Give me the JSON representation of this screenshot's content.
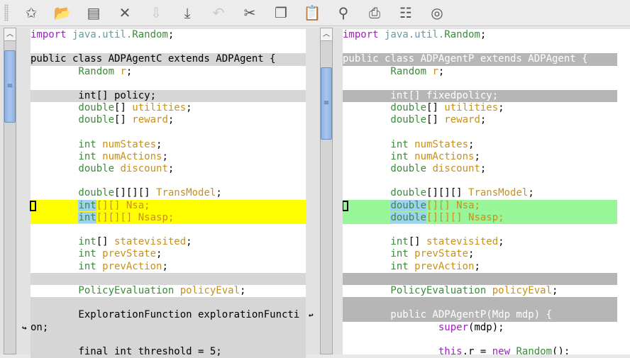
{
  "toolbar": {
    "icons": [
      "new-file-icon",
      "open-folder-icon",
      "save-icon",
      "close-icon",
      "download-icon",
      "save-as-icon",
      "undo-icon",
      "cut-icon",
      "copy-icon",
      "paste-icon",
      "find-icon",
      "print-icon",
      "settings-icon",
      "help-icon"
    ],
    "glyphs": [
      "✩",
      "📂",
      "▤",
      "✕",
      "⇩",
      "⤓",
      "↶",
      "✂",
      "❐",
      "📋",
      "⚲",
      "⎙",
      "☷",
      "◎"
    ],
    "disabled": [
      4,
      6
    ]
  },
  "left": {
    "lines": [
      {
        "bg": "",
        "tokens": [
          {
            "t": "import",
            "c": "kw"
          },
          {
            "t": " java.util.",
            "c": "pk"
          },
          {
            "t": "Random",
            "c": "ty"
          },
          {
            "t": ";",
            "c": "pl"
          }
        ]
      },
      {
        "bg": "",
        "tokens": []
      },
      {
        "bg": "g",
        "tokens": [
          {
            "t": "public class ADPAgentC extends ADPAgent {",
            "c": "pl"
          }
        ]
      },
      {
        "bg": "",
        "tokens": [
          {
            "t": "        Random",
            "c": "ty"
          },
          {
            "t": " r",
            "c": "id"
          },
          {
            "t": ";",
            "c": "pl"
          }
        ]
      },
      {
        "bg": "",
        "tokens": []
      },
      {
        "bg": "g",
        "tokens": [
          {
            "t": "        int[] policy;",
            "c": "pl"
          }
        ]
      },
      {
        "bg": "",
        "tokens": [
          {
            "t": "        double",
            "c": "ty"
          },
          {
            "t": "[]",
            "c": "pl"
          },
          {
            "t": " utilities",
            "c": "id"
          },
          {
            "t": ";",
            "c": "pl"
          }
        ]
      },
      {
        "bg": "",
        "tokens": [
          {
            "t": "        double",
            "c": "ty"
          },
          {
            "t": "[]",
            "c": "pl"
          },
          {
            "t": " reward",
            "c": "id"
          },
          {
            "t": ";",
            "c": "pl"
          }
        ]
      },
      {
        "bg": "",
        "tokens": []
      },
      {
        "bg": "",
        "tokens": [
          {
            "t": "        int",
            "c": "ty"
          },
          {
            "t": " numStates",
            "c": "id"
          },
          {
            "t": ";",
            "c": "pl"
          }
        ]
      },
      {
        "bg": "",
        "tokens": [
          {
            "t": "        int",
            "c": "ty"
          },
          {
            "t": " numActions",
            "c": "id"
          },
          {
            "t": ";",
            "c": "pl"
          }
        ]
      },
      {
        "bg": "",
        "tokens": [
          {
            "t": "        double",
            "c": "ty"
          },
          {
            "t": " discount",
            "c": "id"
          },
          {
            "t": ";",
            "c": "pl"
          }
        ]
      },
      {
        "bg": "",
        "tokens": []
      },
      {
        "bg": "",
        "tokens": [
          {
            "t": "        double",
            "c": "ty"
          },
          {
            "t": "[][][]",
            "c": "pl"
          },
          {
            "t": " TransModel",
            "c": "id"
          },
          {
            "t": ";",
            "c": "pl"
          }
        ]
      },
      {
        "bg": "y",
        "marker": true,
        "tokens": [
          {
            "t": "        ",
            "c": "pl"
          },
          {
            "t": "int",
            "c": "ty hl"
          },
          {
            "t": "[][] Nsa;",
            "c": "id"
          }
        ]
      },
      {
        "bg": "y",
        "tokens": [
          {
            "t": "        ",
            "c": "pl"
          },
          {
            "t": "int",
            "c": "ty hl"
          },
          {
            "t": "[][][] Nsasp;",
            "c": "id"
          }
        ]
      },
      {
        "bg": "",
        "tokens": []
      },
      {
        "bg": "",
        "tokens": [
          {
            "t": "        int",
            "c": "ty"
          },
          {
            "t": "[]",
            "c": "pl"
          },
          {
            "t": " statevisited",
            "c": "id"
          },
          {
            "t": ";",
            "c": "pl"
          }
        ]
      },
      {
        "bg": "",
        "tokens": [
          {
            "t": "        int",
            "c": "ty"
          },
          {
            "t": " prevState",
            "c": "id"
          },
          {
            "t": ";",
            "c": "pl"
          }
        ]
      },
      {
        "bg": "",
        "tokens": [
          {
            "t": "        int",
            "c": "ty"
          },
          {
            "t": " prevAction",
            "c": "id"
          },
          {
            "t": ";",
            "c": "pl"
          }
        ]
      },
      {
        "bg": "g",
        "tokens": []
      },
      {
        "bg": "",
        "tokens": [
          {
            "t": "        PolicyEvaluation",
            "c": "ty"
          },
          {
            "t": " policyEval",
            "c": "id"
          },
          {
            "t": ";",
            "c": "pl"
          }
        ]
      },
      {
        "bg": "g",
        "tokens": []
      },
      {
        "bg": "g",
        "wrapOut": true,
        "tokens": [
          {
            "t": "        ExplorationFunction explorationFuncti",
            "c": "pl"
          }
        ]
      },
      {
        "bg": "g",
        "wrapIn": true,
        "tokens": [
          {
            "t": "on;",
            "c": "pl"
          }
        ]
      },
      {
        "bg": "g",
        "tokens": []
      },
      {
        "bg": "g",
        "tokens": [
          {
            "t": "        final int threshold = 5;",
            "c": "pl"
          }
        ]
      }
    ]
  },
  "right": {
    "lines": [
      {
        "bg": "",
        "tokens": [
          {
            "t": "import",
            "c": "kw"
          },
          {
            "t": " java.util.",
            "c": "pk"
          },
          {
            "t": "Random",
            "c": "ty"
          },
          {
            "t": ";",
            "c": "pl"
          }
        ]
      },
      {
        "bg": "",
        "tokens": []
      },
      {
        "bg": "dg",
        "tokens": [
          {
            "t": "public class ADPAgentP extends ADPAgent {",
            "c": "pl"
          }
        ]
      },
      {
        "bg": "",
        "tokens": [
          {
            "t": "        Random",
            "c": "ty"
          },
          {
            "t": " r",
            "c": "id"
          },
          {
            "t": ";",
            "c": "pl"
          }
        ]
      },
      {
        "bg": "",
        "tokens": []
      },
      {
        "bg": "dg",
        "tokens": [
          {
            "t": "        int[] fixedpolicy;",
            "c": "pl"
          }
        ]
      },
      {
        "bg": "",
        "tokens": [
          {
            "t": "        double",
            "c": "ty"
          },
          {
            "t": "[]",
            "c": "pl"
          },
          {
            "t": " utilities",
            "c": "id"
          },
          {
            "t": ";",
            "c": "pl"
          }
        ]
      },
      {
        "bg": "",
        "tokens": [
          {
            "t": "        double",
            "c": "ty"
          },
          {
            "t": "[]",
            "c": "pl"
          },
          {
            "t": " reward",
            "c": "id"
          },
          {
            "t": ";",
            "c": "pl"
          }
        ]
      },
      {
        "bg": "",
        "tokens": []
      },
      {
        "bg": "",
        "tokens": [
          {
            "t": "        int",
            "c": "ty"
          },
          {
            "t": " numStates",
            "c": "id"
          },
          {
            "t": ";",
            "c": "pl"
          }
        ]
      },
      {
        "bg": "",
        "tokens": [
          {
            "t": "        int",
            "c": "ty"
          },
          {
            "t": " numActions",
            "c": "id"
          },
          {
            "t": ";",
            "c": "pl"
          }
        ]
      },
      {
        "bg": "",
        "tokens": [
          {
            "t": "        double",
            "c": "ty"
          },
          {
            "t": " discount",
            "c": "id"
          },
          {
            "t": ";",
            "c": "pl"
          }
        ]
      },
      {
        "bg": "",
        "tokens": []
      },
      {
        "bg": "",
        "tokens": [
          {
            "t": "        double",
            "c": "ty"
          },
          {
            "t": "[][][]",
            "c": "pl"
          },
          {
            "t": " TransModel",
            "c": "id"
          },
          {
            "t": ";",
            "c": "pl"
          }
        ]
      },
      {
        "bg": "gr",
        "marker": true,
        "tokens": [
          {
            "t": "        ",
            "c": "pl"
          },
          {
            "t": "double",
            "c": "ty hl"
          },
          {
            "t": "[][] Nsa;",
            "c": "id"
          }
        ]
      },
      {
        "bg": "gr",
        "tokens": [
          {
            "t": "        ",
            "c": "pl"
          },
          {
            "t": "double",
            "c": "ty hl"
          },
          {
            "t": "[][][] Nsasp;",
            "c": "id"
          }
        ]
      },
      {
        "bg": "",
        "tokens": []
      },
      {
        "bg": "",
        "tokens": [
          {
            "t": "        int",
            "c": "ty"
          },
          {
            "t": "[]",
            "c": "pl"
          },
          {
            "t": " statevisited",
            "c": "id"
          },
          {
            "t": ";",
            "c": "pl"
          }
        ]
      },
      {
        "bg": "",
        "tokens": [
          {
            "t": "        int",
            "c": "ty"
          },
          {
            "t": " prevState",
            "c": "id"
          },
          {
            "t": ";",
            "c": "pl"
          }
        ]
      },
      {
        "bg": "",
        "tokens": [
          {
            "t": "        int",
            "c": "ty"
          },
          {
            "t": " prevAction",
            "c": "id"
          },
          {
            "t": ";",
            "c": "pl"
          }
        ]
      },
      {
        "bg": "dg",
        "tokens": []
      },
      {
        "bg": "",
        "tokens": [
          {
            "t": "        PolicyEvaluation",
            "c": "ty"
          },
          {
            "t": " policyEval",
            "c": "id"
          },
          {
            "t": ";",
            "c": "pl"
          }
        ]
      },
      {
        "bg": "dg",
        "tokens": []
      },
      {
        "bg": "dg",
        "tokens": [
          {
            "t": "        public ADPAgentP(Mdp mdp) {",
            "c": "pl"
          }
        ]
      },
      {
        "bg": "",
        "tokens": [
          {
            "t": "                super",
            "c": "kw"
          },
          {
            "t": "(mdp);",
            "c": "pl"
          }
        ]
      },
      {
        "bg": "",
        "tokens": []
      },
      {
        "bg": "",
        "tokens": [
          {
            "t": "                this",
            "c": "kw"
          },
          {
            "t": ".r = ",
            "c": "pl"
          },
          {
            "t": "new",
            "c": "kw"
          },
          {
            "t": " Random",
            "c": "ty"
          },
          {
            "t": "();",
            "c": "pl"
          }
        ]
      }
    ]
  }
}
